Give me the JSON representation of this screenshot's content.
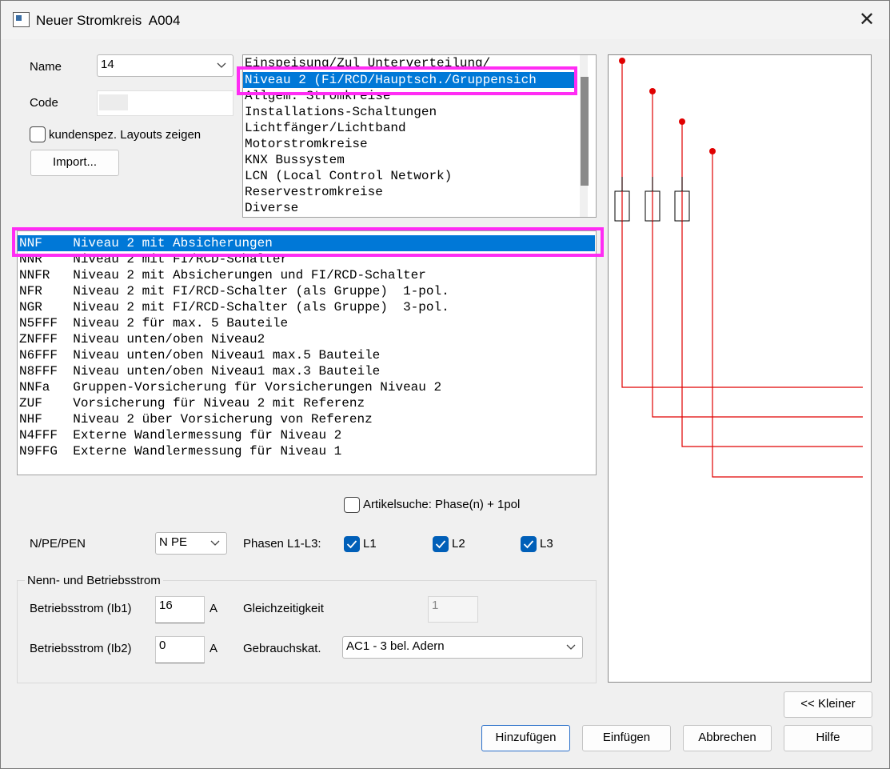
{
  "window": {
    "title": "Neuer Stromkreis  A004"
  },
  "form": {
    "name_label": "Name",
    "name_value": "14",
    "code_label": "Code",
    "code_value": "",
    "custom_layouts_label": "kundenspez. Layouts zeigen",
    "import_button": "Import...",
    "article_search_label": "Artikelsuche: Phase(n) + 1pol",
    "npe_label": "N/PE/PEN",
    "npe_value": "N PE",
    "phases_label": "Phasen L1-L3:",
    "phase_l1": "L1",
    "phase_l2": "L2",
    "phase_l3": "L3",
    "group_title": "Nenn- und Betriebsstrom",
    "ib1_label": "Betriebsstrom (Ib1)",
    "ib1_value": "16",
    "ib1_unit": "A",
    "ib2_label": "Betriebsstrom (Ib2)",
    "ib2_value": "0",
    "ib2_unit": "A",
    "gleichzeitigkeit_label": "Gleichzeitigkeit",
    "gleichzeitigkeit_value": "1",
    "gebrauchskat_label": "Gebrauchskat.",
    "gebrauchskat_value": "AC1 - 3 bel. Adern"
  },
  "category_list": {
    "items": [
      "Einspeisung/Zul Unterverteilung/",
      "Niveau 2 (Fi/RCD/Hauptsch./Gruppensich",
      "Allgem. Stromkreise",
      "Installations-Schaltungen",
      "Lichtfänger/Lichtband",
      "Motorstromkreise",
      "KNX Bussystem",
      "LCN (Local Control Network)",
      "Reservestromkreise",
      "Diverse"
    ],
    "selected_index": 1
  },
  "layout_list": {
    "items": [
      "NNF    Niveau 2 mit Absicherungen",
      "NNR    Niveau 2 mit FI/RCD-Schalter",
      "NNFR   Niveau 2 mit Absicherungen und FI/RCD-Schalter",
      "NFR    Niveau 2 mit FI/RCD-Schalter (als Gruppe)  1-pol.",
      "NGR    Niveau 2 mit FI/RCD-Schalter (als Gruppe)  3-pol.",
      "N5FFF  Niveau 2 für max. 5 Bauteile",
      "ZNFFF  Niveau unten/oben Niveau2",
      "N6FFF  Niveau unten/oben Niveau1 max.5 Bauteile",
      "N8FFF  Niveau unten/oben Niveau1 max.3 Bauteile",
      "NNFa   Gruppen-Vorsicherung für Vorsicherungen Niveau 2",
      "ZUF    Vorsicherung für Niveau 2 mit Referenz",
      "NHF    Niveau 2 über Vorsicherung von Referenz",
      "N4FFF  Externe Wandlermessung für Niveau 2",
      "N9FFG  Externe Wandlermessung für Niveau 1"
    ],
    "selected_index": 0
  },
  "buttons": {
    "smaller": "<< Kleiner",
    "add": "Hinzufügen",
    "insert": "Einfügen",
    "cancel": "Abbrechen",
    "help": "Hilfe"
  },
  "colors": {
    "selection": "#0078d7",
    "highlight": "#ff2cf4",
    "wire": "#e00000",
    "checkbox_checked": "#005fb8"
  }
}
